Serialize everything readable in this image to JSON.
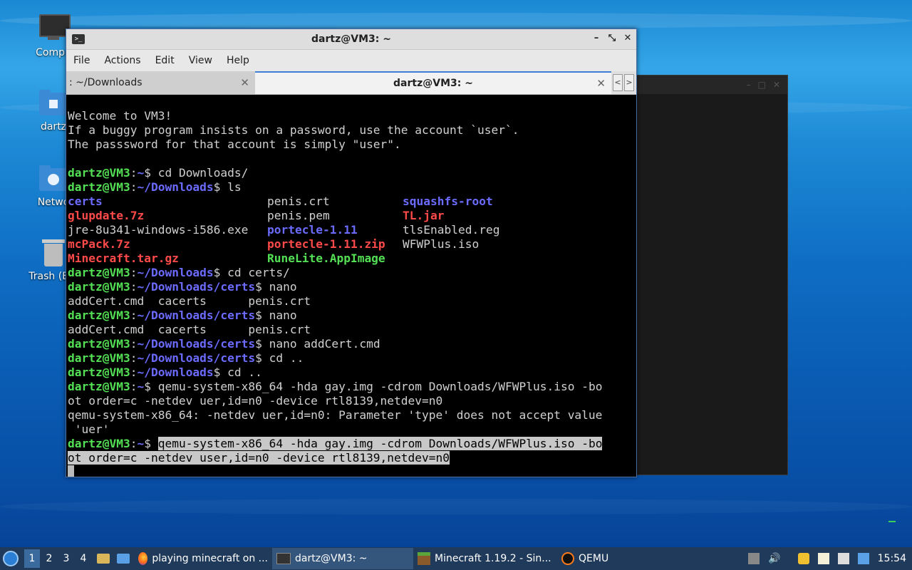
{
  "desktop": {
    "icons": [
      {
        "label": "Compu"
      },
      {
        "label": "dartz"
      },
      {
        "label": "Netwo"
      },
      {
        "label": "Trash (Em"
      }
    ]
  },
  "window": {
    "title": "dartz@VM3: ~",
    "icon": "terminal-icon",
    "controls": {
      "minimize": "–",
      "maximize": "⤡",
      "close": "✕"
    }
  },
  "menubar": {
    "items": [
      "File",
      "Actions",
      "Edit",
      "View",
      "Help"
    ]
  },
  "tabs": [
    {
      "label": ": ~/Downloads",
      "close": "✕"
    },
    {
      "label": "dartz@VM3: ~",
      "close": "✕"
    }
  ],
  "tabnav": {
    "prev": "<",
    "next": ">"
  },
  "terminal": {
    "prompt_user": "dartz@VM3",
    "lines": {
      "l1": "Welcome to VM3!",
      "l2": "If a buggy program insists on a password, use the account `user`.",
      "l3": "The passsword for that account is simply \"user\".",
      "c1_path": "~",
      "c1_cmd": " cd Downloads/",
      "c2_path": "~/Downloads",
      "c2_cmd": " ls",
      "ls1a": "certs",
      "ls1b": "penis.crt",
      "ls1c": "squashfs-root",
      "ls2a": "glupdate.7z",
      "ls2b": "penis.pem",
      "ls2c": "TL.jar",
      "ls3a": "jre-8u341-windows-i586.exe",
      "ls3b": "portecle-1.11",
      "ls3c": "tlsEnabled.reg",
      "ls4a": "mcPack.7z",
      "ls4b": "portecle-1.11.zip",
      "ls4c": "WFWPlus.iso",
      "ls5a": "Minecraft.tar.gz",
      "ls5b": "RuneLite.AppImage",
      "c3_path": "~/Downloads",
      "c3_cmd": " cd certs/",
      "c4_path1": "~/Downloads/",
      "c4_path2": "certs",
      "c4_cmd": " nano",
      "o4": "addCert.cmd  cacerts      penis.crt",
      "c5_path1": "~/Downloads/",
      "c5_path2": "certs",
      "c5_cmd": " nano",
      "o5": "addCert.cmd  cacerts      penis.crt",
      "c6_path1": "~/Downloads/",
      "c6_path2": "certs",
      "c6_cmd": " nano addCert.cmd",
      "c7_path1": "~/Downloads/",
      "c7_path2": "certs",
      "c7_cmd": " cd ..",
      "c8_path": "~/Downloads",
      "c8_cmd": " cd ..",
      "c9_path": "~",
      "c9_cmd": " qemu-system-x86_64 -hda gay.img -cdrom Downloads/WFWPlus.iso -bo",
      "c9b": "ot order=c -netdev uer,id=n0 -device rtl8139,netdev=n0",
      "e1": "qemu-system-x86_64: -netdev uer,id=n0: Parameter 'type' does not accept value",
      "e2": " 'uer'",
      "c10_path": "~",
      "c10_sel1": "qemu-system-x86_64 -hda gay.img -cdrom Downloads/WFWPlus.iso -bo",
      "c10_sel2": "ot order=c -netdev user,id=n0 -device rtl8139,netdev=n0"
    }
  },
  "taskbar": {
    "workspaces": [
      "1",
      "2",
      "3",
      "4"
    ],
    "tasks": [
      {
        "label": "playing minecraft on ...",
        "icon": "firefox-icon"
      },
      {
        "label": "dartz@VM3: ~",
        "icon": "terminal-icon"
      },
      {
        "label": "Minecraft 1.19.2 - Sin...",
        "icon": "minecraft-icon"
      },
      {
        "label": "QEMU",
        "icon": "qemu-icon"
      }
    ],
    "clock": "15:54"
  }
}
